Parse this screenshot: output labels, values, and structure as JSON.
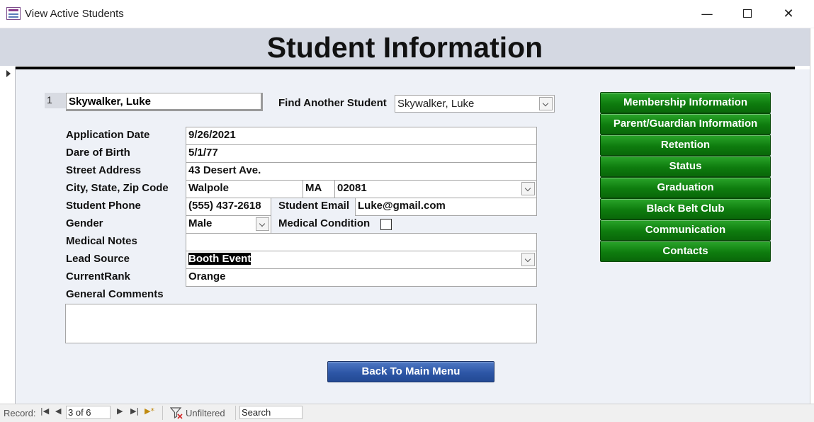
{
  "window": {
    "title": "View Active Students",
    "min_glyph": "—",
    "close_glyph": "✕"
  },
  "form": {
    "title": "Student Information",
    "record_id": "1",
    "student_name": "Skywalker, Luke",
    "find_label": "Find Another Student",
    "find_value": "Skywalker, Luke"
  },
  "fields": {
    "application_date": {
      "label": "Application Date",
      "value": "9/26/2021"
    },
    "date_of_birth": {
      "label": "Dare of Birth",
      "value": "5/1/77"
    },
    "street_address": {
      "label": "Street Address",
      "value": "43 Desert Ave."
    },
    "city_state_zip": {
      "label": "City, State, Zip Code",
      "city": "Walpole",
      "state": "MA",
      "zip": "02081"
    },
    "student_phone": {
      "label": "Student Phone",
      "value": "(555) 437-2618"
    },
    "student_email": {
      "label": "Student Email",
      "value": "Luke@gmail.com"
    },
    "gender": {
      "label": "Gender",
      "value": "Male"
    },
    "medical_condition": {
      "label": "Medical Condition",
      "checked": false
    },
    "medical_notes": {
      "label": "Medical Notes",
      "value": ""
    },
    "lead_source": {
      "label": "Lead Source",
      "value": "Booth Event"
    },
    "current_rank": {
      "label": "CurrentRank",
      "value": "Orange"
    },
    "general_comments": {
      "label": "General Comments",
      "value": ""
    }
  },
  "side_buttons": [
    "Membership Information",
    "Parent/Guardian Information",
    "Retention",
    "Status",
    "Graduation",
    "Black Belt Club",
    "Communication",
    "Contacts"
  ],
  "back_button": "Back To Main Menu",
  "navbar": {
    "record_label": "Record:",
    "position": "3 of 6",
    "filter_label": "Unfiltered",
    "search_label": "Search",
    "first_glyph": "|◀",
    "prev_glyph": "◀",
    "next_glyph": "▶",
    "last_glyph": "▶|",
    "new_glyph": "▶*"
  },
  "colors": {
    "button_green": "#0e7c0e",
    "button_blue": "#2d56a6",
    "header_bg": "#d4d8e2",
    "detail_bg": "#eef1f7"
  }
}
